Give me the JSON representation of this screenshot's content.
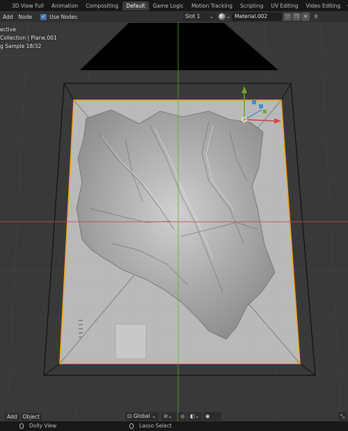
{
  "workspace_tabs": [
    {
      "label": "3D View Full",
      "active": false
    },
    {
      "label": "Animation",
      "active": false
    },
    {
      "label": "Compositing",
      "active": false
    },
    {
      "label": "Default",
      "active": true
    },
    {
      "label": "Game Logic",
      "active": false
    },
    {
      "label": "Motion Tracking",
      "active": false
    },
    {
      "label": "Scripting",
      "active": false
    },
    {
      "label": "UV Editing",
      "active": false
    },
    {
      "label": "Video Editing",
      "active": false
    }
  ],
  "add_workspace_icon": "plus-icon",
  "node_header": {
    "add_label": "Add",
    "node_label": "Node",
    "use_nodes_label": "Use Nodes",
    "use_nodes_checked": true,
    "slot_value": "Slot 1",
    "material_name": "Material.002",
    "icons": [
      "material-sphere-icon",
      "shield-icon",
      "copy-icon",
      "close-icon",
      "pin-icon"
    ]
  },
  "viewport_overlay": {
    "line1": "ective",
    "line2": "Collection | Plane.001",
    "line3": "g Sample 18/32"
  },
  "viewport_footer": {
    "add_label": "Add",
    "object_label": "Object",
    "orientation_value": "Global",
    "icons": [
      "transform-orientation-icon",
      "link-icon",
      "snap-icon",
      "proportional-edit-icon",
      "overlay-icon",
      "falloff-icon",
      "gizmo-icon"
    ]
  },
  "status_bar": {
    "left_hint": "Dolly View",
    "middle_hint": "Lasso Select"
  },
  "colors": {
    "accent_blue": "#4772b3",
    "selection_orange": "#f5a623",
    "axis_x_red": "#c9454a",
    "axis_y_green": "#6ca72a",
    "viewport_bg": "#393939"
  }
}
